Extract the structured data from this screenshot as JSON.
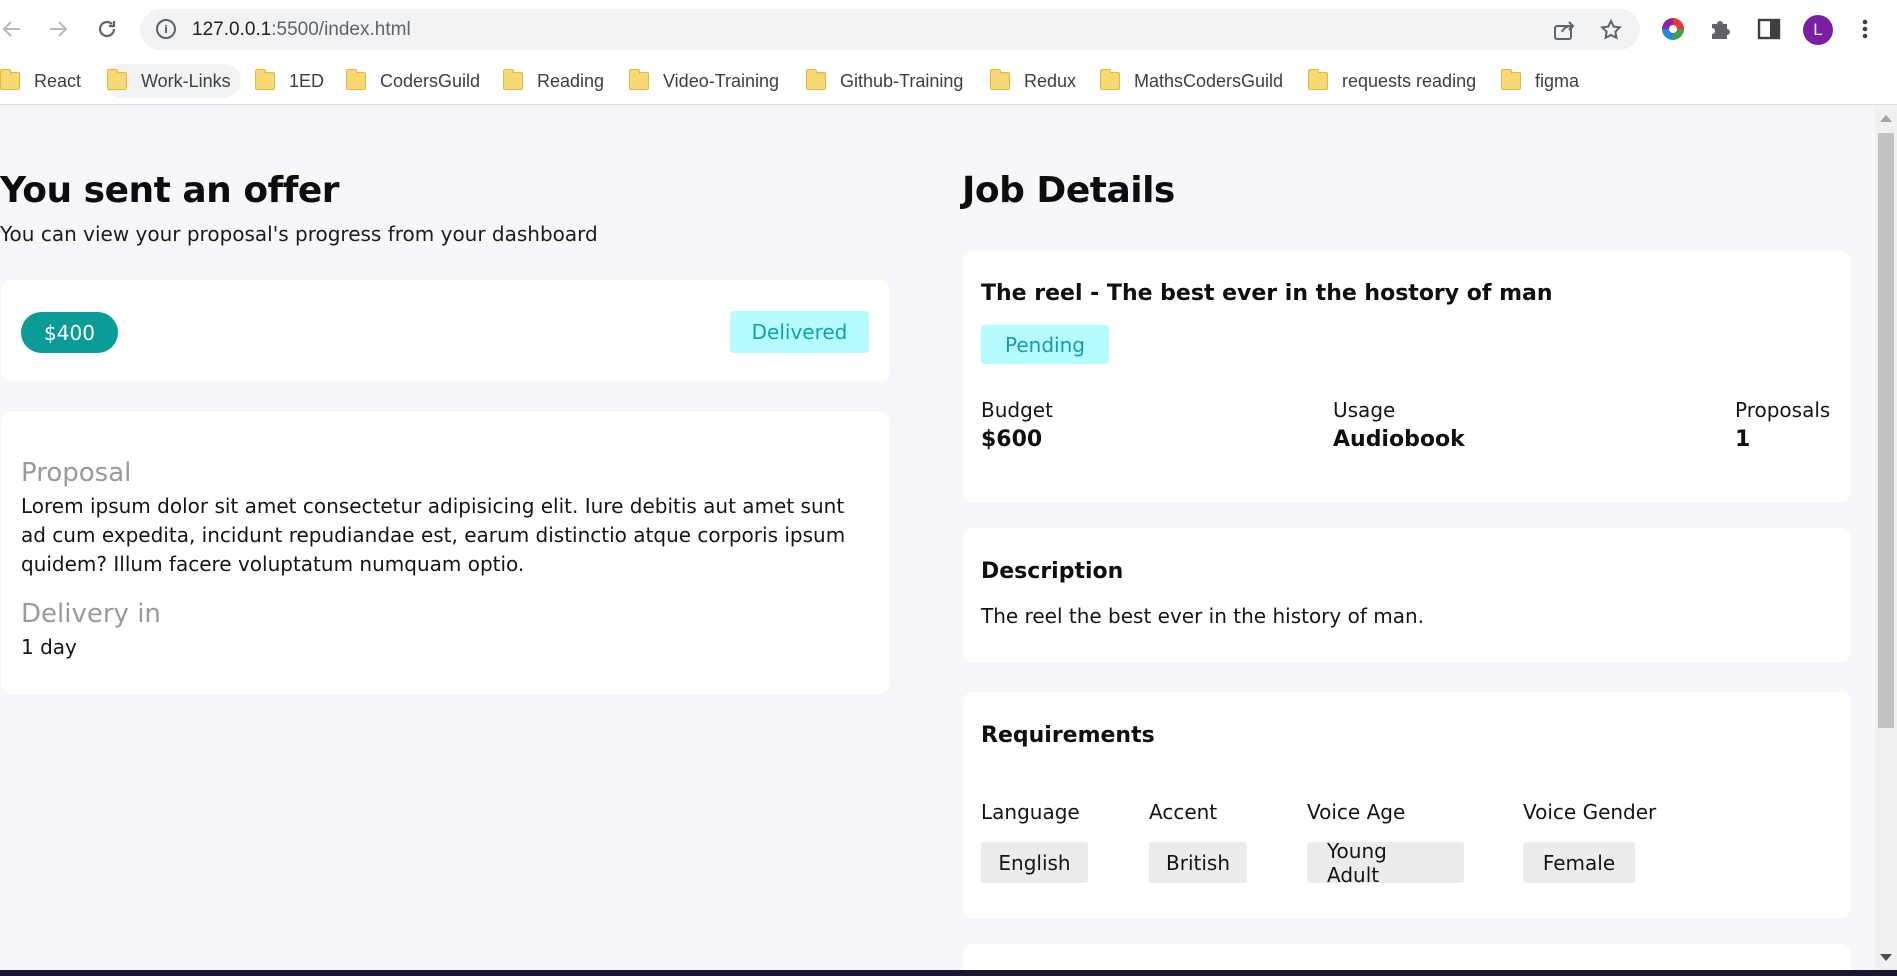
{
  "browser": {
    "url_host": "127.0.0.1",
    "url_path": ":5500/index.html",
    "profile_initial": "L",
    "icons": [
      "back-icon",
      "forward-icon",
      "reload-icon",
      "site-info-icon",
      "share-icon",
      "star-icon",
      "color-wheel-extension-icon",
      "puzzle-icon",
      "side-panel-icon",
      "kebab-menu-icon"
    ]
  },
  "bookmarks": [
    "React",
    "Work-Links",
    "1ED",
    "CodersGuild",
    "Reading",
    "Video-Training",
    "Github-Training",
    "Redux",
    "MathsCodersGuild",
    "requests reading",
    "figma"
  ],
  "offer": {
    "heading": "You sent an offer",
    "subheading": "You can view your proposal's progress from your dashboard",
    "price": "$400",
    "status": "Delivered",
    "proposal_label": "Proposal",
    "proposal_text": "Lorem ipsum dolor sit amet consectetur adipisicing elit. Iure debitis aut amet sunt ad cum expedita, incidunt repudiandae est, earum distinctio atque corporis ipsum quidem? Illum facere voluptatum numquam optio.",
    "delivery_label": "Delivery in",
    "delivery_value": "1 day"
  },
  "job": {
    "heading": "Job Details",
    "title": "The reel - The best ever in the hostory of man",
    "status": "Pending",
    "budget_label": "Budget",
    "budget_value": "$600",
    "usage_label": "Usage",
    "usage_value": "Audiobook",
    "proposals_label": "Proposals",
    "proposals_value": "1",
    "description_label": "Description",
    "description_text": "The reel the best ever in the history of man.",
    "requirements_label": "Requirements",
    "requirements": [
      {
        "label": "Language",
        "value": "English"
      },
      {
        "label": "Accent",
        "value": "British"
      },
      {
        "label": "Voice Age",
        "value": "Young Adult"
      },
      {
        "label": "Voice Gender",
        "value": "Female"
      }
    ]
  },
  "colors": {
    "accent_teal": "#0b9c98",
    "status_bg": "#b6fbfd",
    "status_text": "#11a39d",
    "page_bg": "#f6f7fa"
  }
}
